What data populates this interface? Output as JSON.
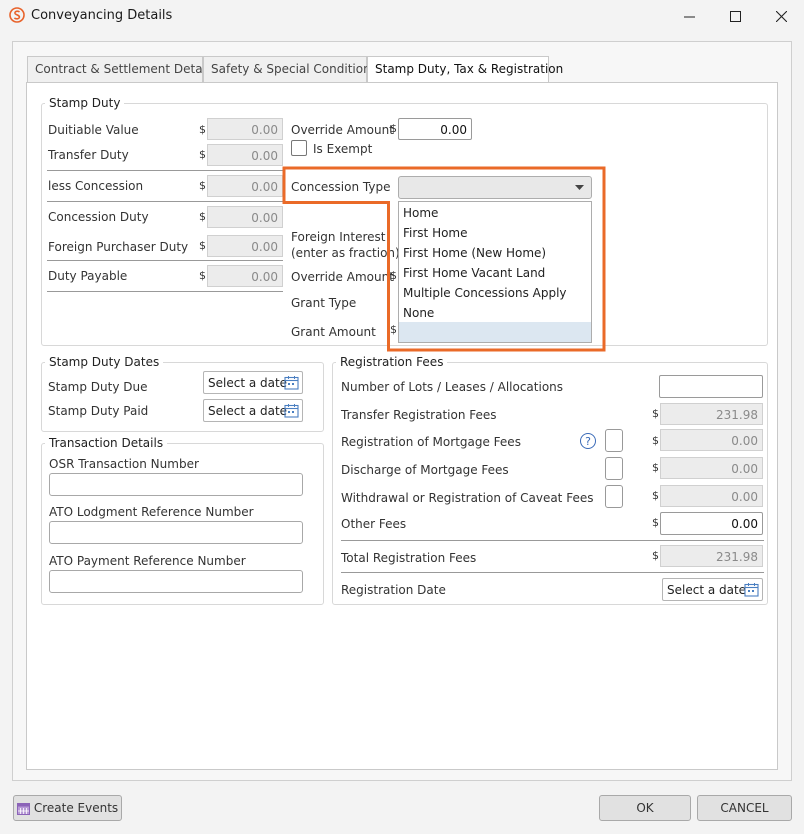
{
  "window": {
    "title": "Conveyancing Details"
  },
  "tabs": [
    {
      "label": "Contract & Settlement Details"
    },
    {
      "label": "Safety & Special Conditions"
    },
    {
      "label": "Stamp Duty, Tax & Registration"
    }
  ],
  "stamp_duty": {
    "title": "Stamp Duty",
    "currency": "$",
    "dutiable_value": {
      "label": "Duitiable Value",
      "value": "0.00"
    },
    "transfer_duty": {
      "label": "Transfer Duty",
      "value": "0.00"
    },
    "less_concession": {
      "label": "less Concession",
      "value": "0.00"
    },
    "concession_duty": {
      "label": "Concession Duty",
      "value": "0.00"
    },
    "foreign_purchaser_duty": {
      "label": "Foreign Purchaser Duty",
      "value": "0.00"
    },
    "duty_payable": {
      "label": "Duty Payable",
      "value": "0.00"
    },
    "override_amount": {
      "label": "Override Amount",
      "value": "0.00"
    },
    "is_exempt": {
      "label": "Is Exempt"
    },
    "concession_type": {
      "label": "Concession Type",
      "value": ""
    },
    "foreign_interest": {
      "label_line1": "Foreign Interest",
      "label_line2": "(enter as fraction)"
    },
    "override_amount_2": {
      "label": "Override Amount"
    },
    "grant_type": {
      "label": "Grant Type"
    },
    "grant_amount": {
      "label": "Grant Amount"
    },
    "concession_options": [
      "Home",
      "First Home",
      "First Home (New Home)",
      "First Home Vacant Land",
      "Multiple Concessions Apply",
      "None",
      ""
    ]
  },
  "stamp_duty_dates": {
    "title": "Stamp Duty Dates",
    "due": {
      "label": "Stamp Duty Due",
      "placeholder": "Select a date"
    },
    "paid": {
      "label": "Stamp Duty Paid",
      "placeholder": "Select a date"
    }
  },
  "transaction_details": {
    "title": "Transaction Details",
    "osr": {
      "label": "OSR Transaction Number",
      "value": ""
    },
    "ato_lodgment": {
      "label": "ATO Lodgment Reference Number",
      "value": ""
    },
    "ato_payment": {
      "label": "ATO Payment Reference Number",
      "value": ""
    }
  },
  "registration_fees": {
    "title": "Registration Fees",
    "currency": "$",
    "lots": {
      "label": "Number of Lots / Leases / Allocations",
      "value": ""
    },
    "transfer": {
      "label": "Transfer Registration Fees",
      "value": "231.98"
    },
    "mortgage": {
      "label": "Registration of Mortgage Fees",
      "value": "0.00"
    },
    "discharge": {
      "label": "Discharge of Mortgage Fees",
      "value": "0.00"
    },
    "caveat": {
      "label": "Withdrawal or Registration of Caveat Fees",
      "value": "0.00"
    },
    "other": {
      "label": "Other Fees",
      "value": "0.00"
    },
    "total": {
      "label": "Total Registration Fees",
      "value": "231.98"
    },
    "date": {
      "label": "Registration Date",
      "placeholder": "Select a date"
    },
    "help_glyph": "?"
  },
  "footer": {
    "create_events": "Create Events",
    "ok": "OK",
    "cancel": "CANCEL"
  },
  "colors": {
    "highlight": "#ea6a28",
    "brand": "#e8622a"
  }
}
